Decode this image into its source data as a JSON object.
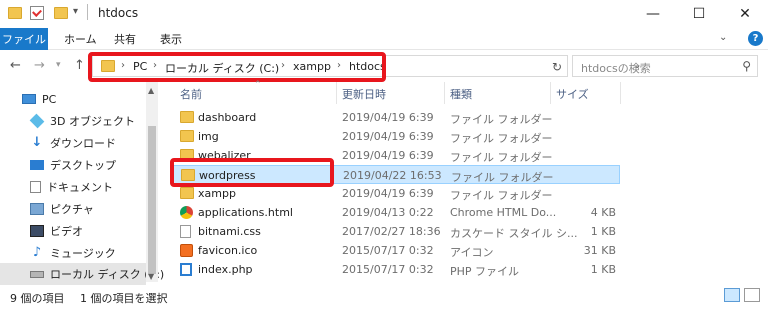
{
  "window": {
    "title": "htdocs",
    "minimize": "—",
    "maximize": "☐",
    "close": "✕"
  },
  "ribbon": {
    "tabs": [
      "ファイル",
      "ホーム",
      "共有",
      "表示"
    ],
    "expand": "⌄",
    "help": "?"
  },
  "address": {
    "crumbs": [
      "PC",
      "ローカル ディスク (C:)",
      "xampp",
      "htdocs"
    ],
    "sep": "›"
  },
  "search": {
    "placeholder": "htdocsの検索"
  },
  "sidebar": {
    "items": [
      {
        "label": "PC",
        "icon": "pc-icon"
      },
      {
        "label": "3D オブジェクト",
        "icon": "3d-objects-icon"
      },
      {
        "label": "ダウンロード",
        "icon": "download-icon"
      },
      {
        "label": "デスクトップ",
        "icon": "desktop-icon"
      },
      {
        "label": "ドキュメント",
        "icon": "documents-icon"
      },
      {
        "label": "ピクチャ",
        "icon": "pictures-icon"
      },
      {
        "label": "ビデオ",
        "icon": "video-icon"
      },
      {
        "label": "ミュージック",
        "icon": "music-icon"
      },
      {
        "label": "ローカル ディスク (C:)",
        "icon": "local-disk-icon"
      }
    ]
  },
  "columns": [
    "名前",
    "更新日時",
    "種類",
    "サイズ"
  ],
  "files": [
    {
      "name": "dashboard",
      "date": "2019/04/19 6:39",
      "type": "ファイル フォルダー",
      "size": "",
      "icon": "folder-icon"
    },
    {
      "name": "img",
      "date": "2019/04/19 6:39",
      "type": "ファイル フォルダー",
      "size": "",
      "icon": "folder-icon"
    },
    {
      "name": "webalizer",
      "date": "2019/04/19 6:39",
      "type": "ファイル フォルダー",
      "size": "",
      "icon": "folder-icon"
    },
    {
      "name": "wordpress",
      "date": "2019/04/22 16:53",
      "type": "ファイル フォルダー",
      "size": "",
      "icon": "folder-icon",
      "selected": true
    },
    {
      "name": "xampp",
      "date": "2019/04/19 6:39",
      "type": "ファイル フォルダー",
      "size": "",
      "icon": "folder-icon"
    },
    {
      "name": "applications.html",
      "date": "2019/04/13 0:22",
      "type": "Chrome HTML Do...",
      "size": "4 KB",
      "icon": "chrome-icon"
    },
    {
      "name": "bitnami.css",
      "date": "2017/02/27 18:36",
      "type": "カスケード スタイル シ...",
      "size": "1 KB",
      "icon": "css-file-icon"
    },
    {
      "name": "favicon.ico",
      "date": "2015/07/17 0:32",
      "type": "アイコン",
      "size": "31 KB",
      "icon": "ico-file-icon"
    },
    {
      "name": "index.php",
      "date": "2015/07/17 0:32",
      "type": "PHP ファイル",
      "size": "1 KB",
      "icon": "php-file-icon"
    }
  ],
  "status": {
    "count": "9 個の項目",
    "selected": "1 個の項目を選択"
  },
  "colors": {
    "accent": "#1979ca",
    "highlight": "#e8161d",
    "selection": "#cce8ff",
    "folder": "#f2c54f"
  }
}
